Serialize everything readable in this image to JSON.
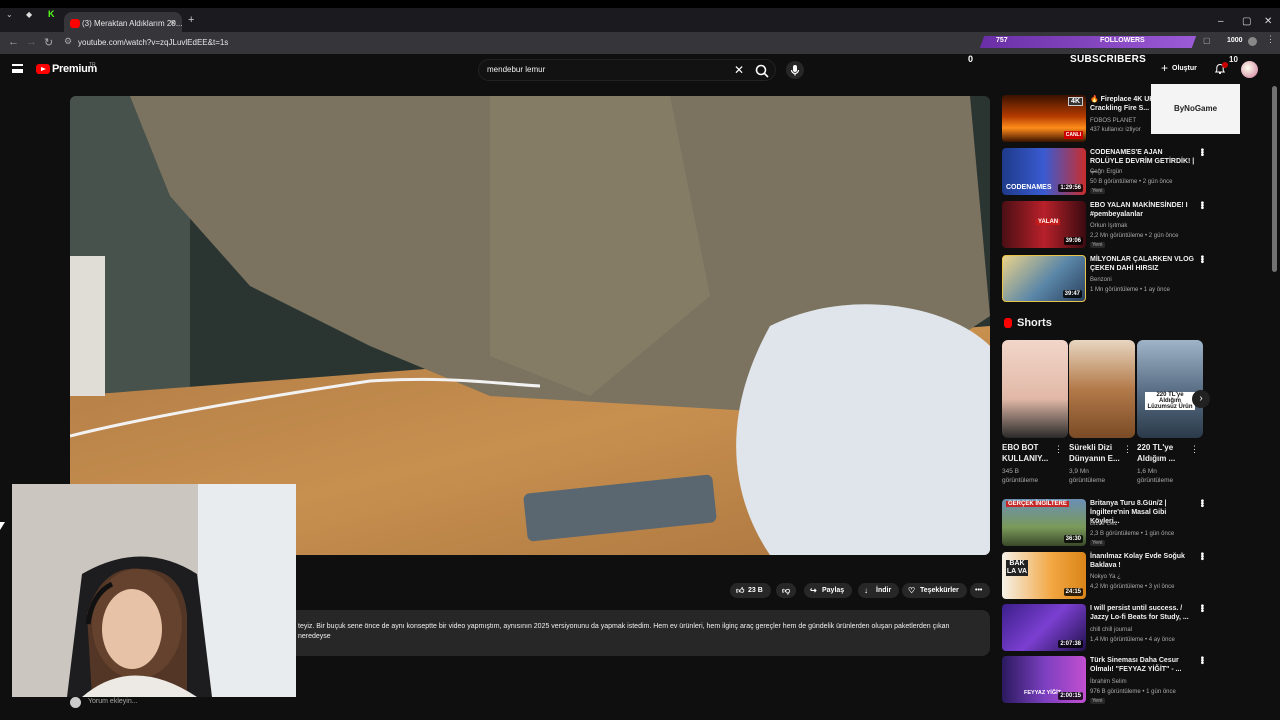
{
  "browser": {
    "tab_title": "(3) Meraktan Aldıklarım 20...",
    "url": "youtube.com/watch?v=zqJLuvlEdEE&t=1s"
  },
  "overlay": {
    "followers_count": "757",
    "followers_label": "FOLLOWERS",
    "right_count": "1000",
    "subscribers_count": "0",
    "subscribers_label": "SUBSCRIBERS",
    "brand_logo": "ByNoGame",
    "notif_count": "10"
  },
  "header": {
    "logo_text": "Premium",
    "logo_region": "TR",
    "search_value": "mendebur lemur",
    "create_label": "Oluştur"
  },
  "actions": {
    "likes": "23 B",
    "share": "Paylaş",
    "download": "İndir",
    "thanks": "Teşekkürler"
  },
  "description": "teyiz. Bir buçuk sene önce de aynı konseptte bir video yapmıştım, aynısının 2025 versiyonunu da yapmak istedim. Hem ev ürünleri, hem ilginç araç gereçler hem de gündelik ürünlerden oluşan paketlerden çıkan neredeyse",
  "comment_placeholder": "Yorum ekleyin...",
  "recommendations_top": [
    {
      "title": "🔥 Fireplace 4K UHD with Crackling Fire S...",
      "channel": "FOBOS PLANET",
      "meta": "437 kullanıcı izliyor",
      "badge": "CANLI",
      "duration": ""
    },
    {
      "title": "CODENAMES'E AJAN ROLÜYLE DEVRİM GETİRDİK! | ...",
      "channel": "Çağrı Ergün",
      "meta": "50 B görüntüleme • 2 gün önce",
      "new": "Yeni",
      "duration": "1:29:56"
    },
    {
      "title": "EBO YALAN MAKİNESİNDE! I #pembeyalanlar",
      "channel": "Orkun Işıtmak",
      "meta": "2,2 Mn görüntüleme • 2 gün önce",
      "new": "Yeni",
      "duration": "39:06"
    },
    {
      "title": "MİLYONLAR ÇALARKEN VLOG ÇEKEN DAHİ HIRSIZ",
      "channel": "Benzoni",
      "meta": "1 Mn görüntüleme • 1 ay önce",
      "duration": "39:47"
    }
  ],
  "shorts": {
    "heading": "Shorts",
    "items": [
      {
        "title": "EBO BOT KULLANIY...",
        "views": "345 B",
        "views_label": "görüntüleme"
      },
      {
        "title": "Sürekli Dizi Dünyanın E...",
        "views": "3,9 Mn",
        "views_label": "görüntüleme"
      },
      {
        "title": "220 TL'ye Aldığım ...",
        "views": "1,6 Mn",
        "views_label": "görüntüleme",
        "thumb_text": "220 TL'ye Aldığım Lüzumsuz Ürün"
      }
    ]
  },
  "recommendations_bottom": [
    {
      "title": "Britanya Turu 8.Gün/2 | İngiltere'nin Masal Gibi Köyleri...",
      "channel": "Bizce Gez",
      "meta": "2,3 B görüntüleme • 1 gün önce",
      "new": "Yeni",
      "duration": "36:30",
      "thumb_text": "GERÇEK İNGİLTERE"
    },
    {
      "title": "İnanılmaz Kolay Evde Soğuk Baklava !",
      "channel": "Nokyo Ya ¿",
      "meta": "4,2 Mn görüntüleme • 3 yıl önce",
      "duration": "24:15",
      "thumb_text": "BAK LA VA"
    },
    {
      "title": "I will persist until success. / Jazzy Lo-fi Beats for Study, ...",
      "channel": "chill chill journal",
      "meta": "1,4 Mn görüntüleme • 4 ay önce",
      "duration": "2:07:38"
    },
    {
      "title": "Türk Sineması Daha Cesur Olmalı! \"FEYYAZ YİĞİT\" - ...",
      "channel": "İbrahim Selim",
      "meta": "976 B görüntüleme • 1 gün önce",
      "new": "Yeni",
      "duration": "2:00:15",
      "thumb_text": "FEYYAZ YİĞİT"
    }
  ],
  "colors": {
    "accent": "#ff0000",
    "bg": "#0f0f0f",
    "chip": "#272727",
    "purple_bar": "#8a47c6"
  }
}
